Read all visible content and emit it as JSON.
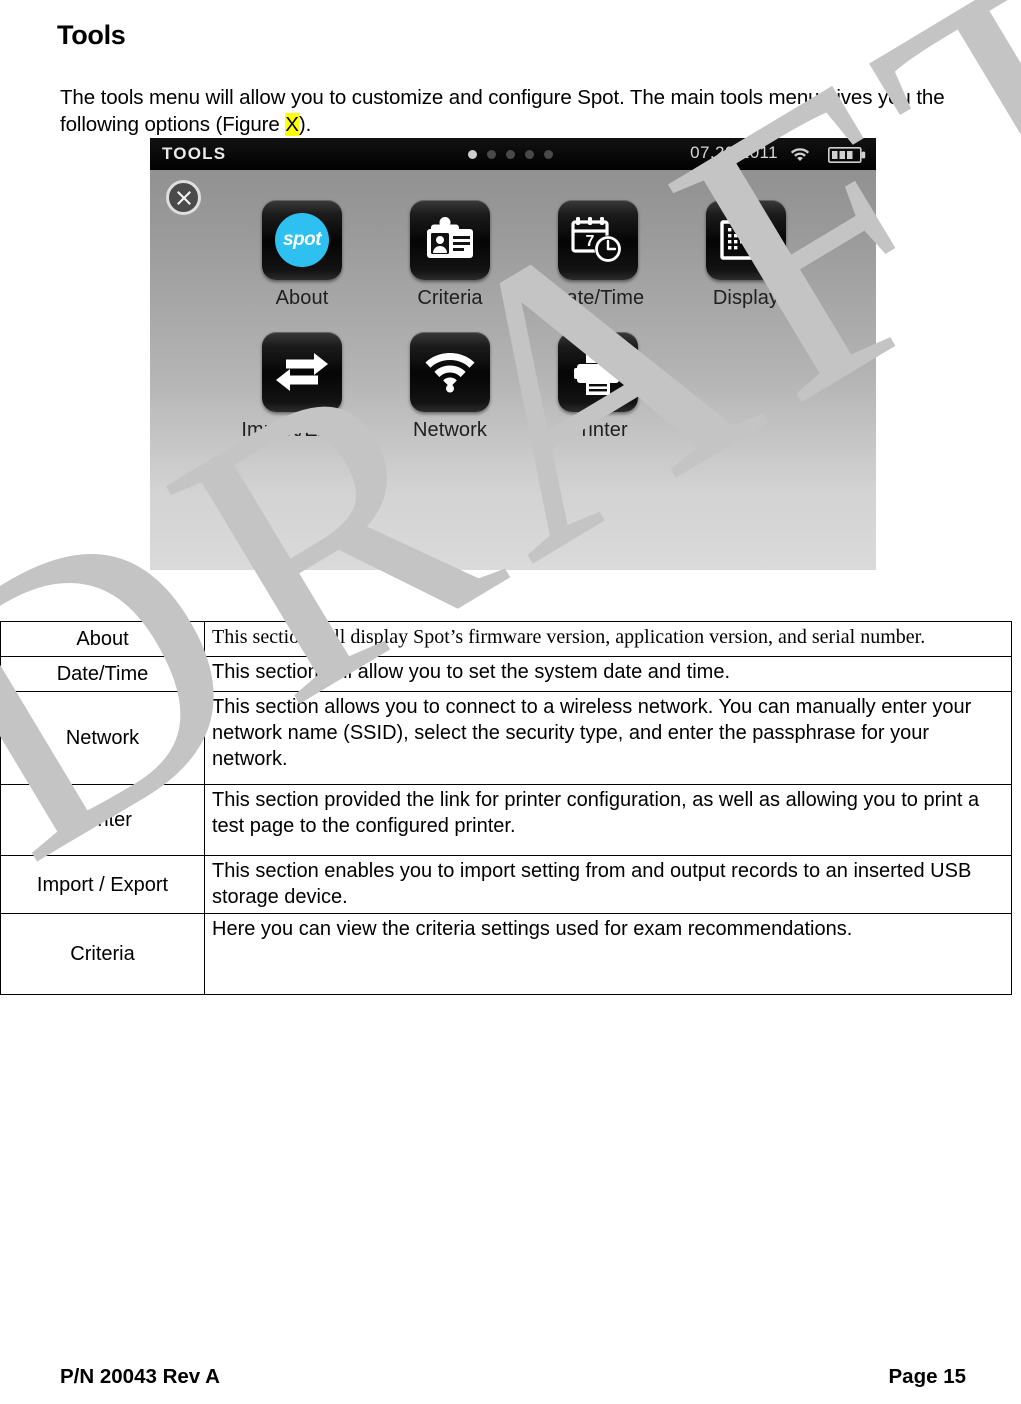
{
  "document": {
    "title": "Tools",
    "intro_before": "The tools menu will allow you to customize and configure Spot.  The main tools menu gives you the following options (Figure ",
    "intro_highlight": "X",
    "intro_after": ").",
    "watermark": "DRAFT"
  },
  "device": {
    "statusbar": {
      "title": "TOOLS",
      "date": "07.20.2011",
      "wifi_icon": "wifi-icon",
      "battery_icon": "battery-icon",
      "battery_bars": 3,
      "pager_dots": 5,
      "pager_active_index": 0
    },
    "close_button_icon": "close-x-icon",
    "apps_row1": [
      {
        "label": "About",
        "icon": "spot-logo-icon"
      },
      {
        "label": "Criteria",
        "icon": "id-badge-icon"
      },
      {
        "label": "Date/Time",
        "icon": "calendar-clock-icon",
        "calendar_day": "7"
      },
      {
        "label": "Display",
        "icon": "display-pixels-icon"
      }
    ],
    "apps_row2": [
      {
        "label": "Import/Export",
        "icon": "two-way-arrow-icon"
      },
      {
        "label": "Network",
        "icon": "wifi-icon"
      },
      {
        "label": "Printer",
        "icon": "printer-icon"
      }
    ]
  },
  "table": {
    "rows": [
      {
        "name": "About",
        "desc": "This section will display Spot’s firmware version, application version, and serial number."
      },
      {
        "name": "Date/Time",
        "desc": "This section will allow you to set the system date and time."
      },
      {
        "name": "Network",
        "desc": "This section allows you to connect to a wireless network. You can manually enter your network name (SSID), select the security type, and enter the passphrase for your network."
      },
      {
        "name": "Printer",
        "desc": "This section provided the link for printer configuration, as well as allowing you to print a test page to the configured printer."
      },
      {
        "name": "Import / Export",
        "desc": "This section enables you to import setting from and output records to an inserted USB storage device."
      },
      {
        "name": "Criteria",
        "desc": "Here you can view the criteria settings used for exam recommendations."
      }
    ]
  },
  "footer": {
    "left": "P/N 20043 Rev A",
    "right": "Page 15"
  },
  "colors": {
    "accent_cyan": "#2ec0f0",
    "highlight_yellow": "#ffff00",
    "watermark_gray": "#c4c4c4"
  }
}
